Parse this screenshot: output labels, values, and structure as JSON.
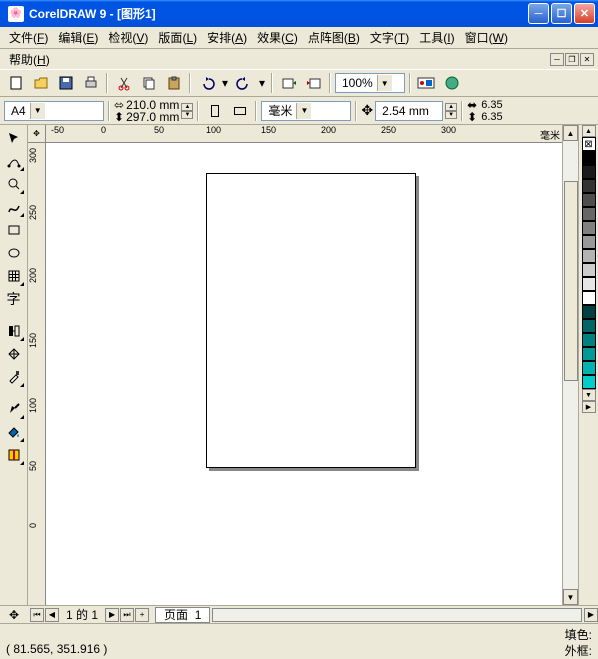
{
  "title": "CorelDRAW 9 - [图形1]",
  "menu": {
    "file": "文件",
    "edit": "编辑",
    "view": "检视",
    "layout": "版面",
    "arrange": "安排",
    "effects": "效果",
    "bitmaps": "点阵图",
    "text": "文字",
    "tools": "工具",
    "window": "窗口",
    "help": "帮助",
    "file_key": "F",
    "edit_key": "E",
    "view_key": "V",
    "layout_key": "L",
    "arrange_key": "A",
    "effects_key": "C",
    "bitmaps_key": "B",
    "text_key": "T",
    "tools_key": "I",
    "window_key": "W",
    "help_key": "H"
  },
  "toolbar": {
    "zoom": "100%"
  },
  "propbar": {
    "paper": "A4",
    "width": "210.0 mm",
    "height": "297.0 mm",
    "units": "毫米",
    "nudge": "2.54 mm",
    "dup_x": "6.35",
    "dup_y": "6.35"
  },
  "ruler": {
    "h": [
      "-50",
      "0",
      "50",
      "100",
      "150",
      "200",
      "250",
      "300"
    ],
    "v": [
      "300",
      "250",
      "200",
      "150",
      "100",
      "50",
      "0"
    ],
    "unit": "毫米"
  },
  "palette": [
    "#000000",
    "#1a1a1a",
    "#333333",
    "#4d4d4d",
    "#666666",
    "#808080",
    "#999999",
    "#b3b3b3",
    "#cccccc",
    "#e6e6e6",
    "#ffffff",
    "#004040",
    "#006666",
    "#008080",
    "#009999",
    "#00b3b3",
    "#00cccc"
  ],
  "page_nav": {
    "first": "⏮",
    "prev": "◀",
    "add_before": "+",
    "text": "1 的 1",
    "add_after": "+",
    "next": "▶",
    "tab_label": "页面",
    "tab_num": "1"
  },
  "status": {
    "coords": "( 81.565, 351.916 )",
    "fill_label": "填色:",
    "outline_label": "外框:"
  }
}
